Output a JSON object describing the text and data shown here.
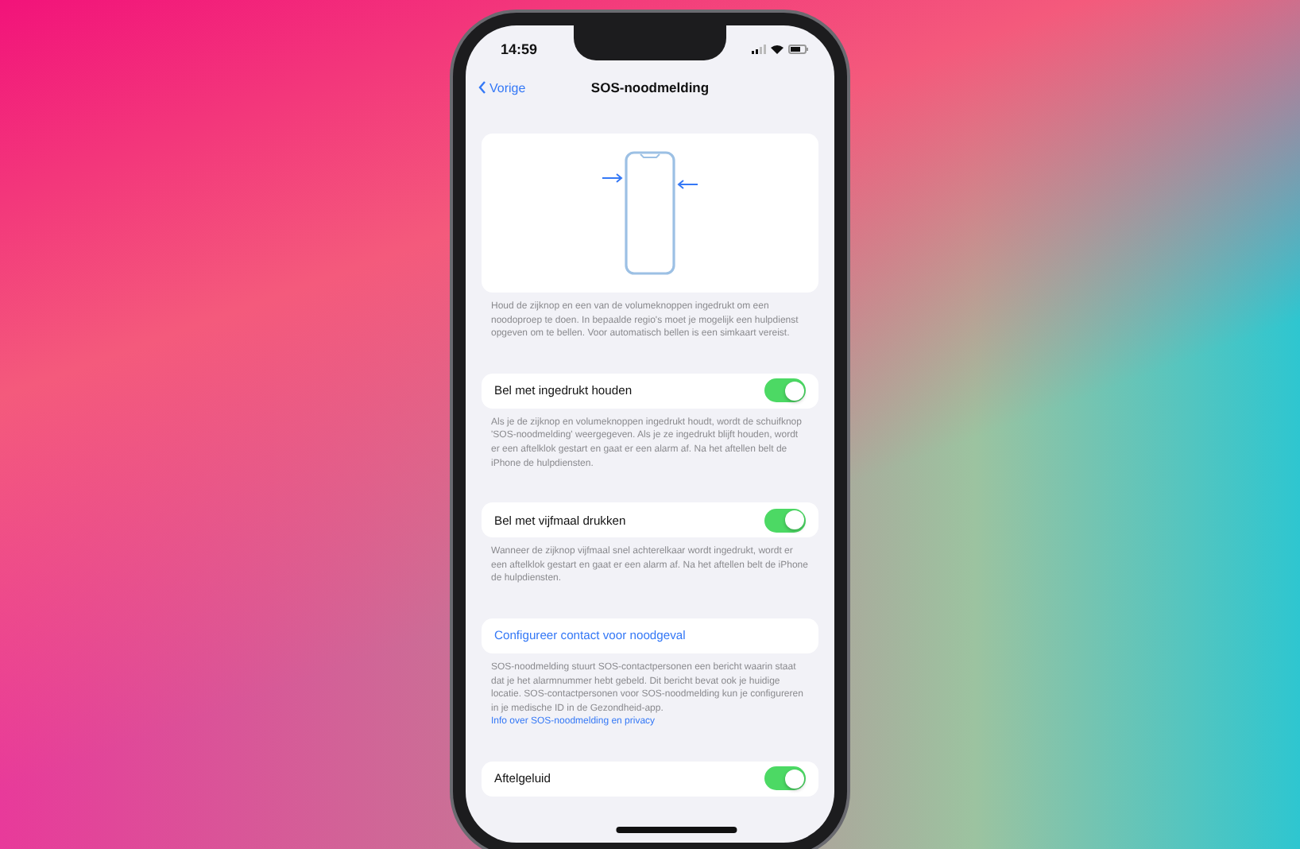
{
  "status_bar": {
    "time": "14:59"
  },
  "nav": {
    "back": "Vorige",
    "title": "SOS-noodmelding"
  },
  "intro_footnote": "Houd de zijknop en een van de volumeknoppen ingedrukt om een noodoproep te doen. In bepaalde regio's moet je mogelijk een hulpdienst opgeven om te bellen. Voor automatisch bellen is een simkaart vereist.",
  "sections": [
    {
      "kind": "toggle",
      "label": "Bel met ingedrukt houden",
      "on": true,
      "footnote": "Als je de zijknop en volumeknoppen ingedrukt houdt, wordt de schuifknop 'SOS-noodmelding' weergegeven. Als je ze ingedrukt blijft houden, wordt er een aftelklok gestart en gaat er een alarm af. Na het aftellen belt de iPhone de hulpdiensten."
    },
    {
      "kind": "toggle",
      "label": "Bel met vijfmaal drukken",
      "on": true,
      "footnote": "Wanneer de zijknop vijfmaal snel achterelkaar wordt ingedrukt, wordt er een aftelklok gestart en gaat er een alarm af. Na het aftellen belt de iPhone de hulpdiensten."
    },
    {
      "kind": "link",
      "label": "Configureer contact voor noodgeval",
      "footnote": "SOS-noodmelding stuurt SOS-contactpersonen een bericht waarin staat dat je het alarmnummer hebt gebeld. Dit bericht bevat ook je huidige locatie. SOS-contactpersonen voor SOS-noodmelding kun je configureren in je medische ID in de Gezondheid-app.",
      "footnote_link": "Info over SOS-noodmelding en privacy"
    },
    {
      "kind": "toggle",
      "label": "Aftelgeluid",
      "on": true
    }
  ]
}
